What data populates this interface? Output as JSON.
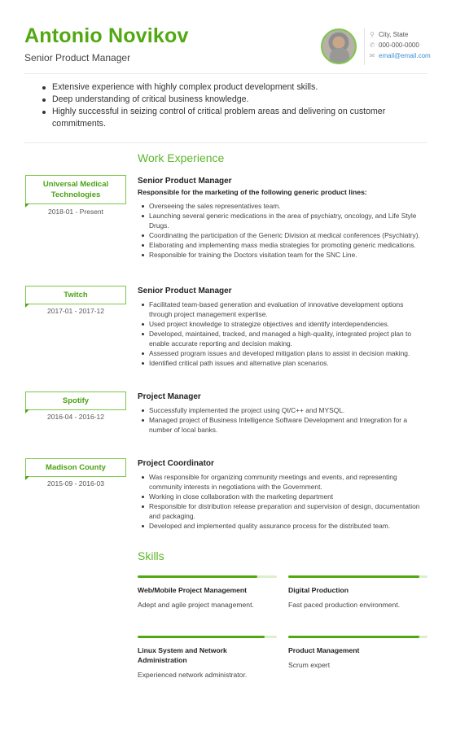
{
  "header": {
    "name": "Antonio Novikov",
    "title": "Senior Product Manager",
    "contact": {
      "location": "City, State",
      "phone": "000-000-0000",
      "email": "email@email.com"
    },
    "icons": {
      "location": "map-pin-icon",
      "phone": "phone-icon",
      "email": "envelope-icon"
    }
  },
  "summary": [
    "Extensive experience with highly complex product development skills.",
    "Deep understanding of critical business knowledge.",
    "Highly successful in seizing control of critical problem areas and delivering on customer commitments."
  ],
  "work_experience": {
    "heading": "Work Experience",
    "jobs": [
      {
        "company": "Universal Medical Technologies",
        "dates": "2018-01 - Present",
        "title": "Senior Product Manager",
        "subtitle": "Responsible for the marketing of the following generic product lines:",
        "bullets": [
          "Overseeing the sales representatives team.",
          "Launching several generic medications in the area of psychiatry, oncology, and Life Style Drugs.",
          "Coordinating the participation of the Generic Division at medical conferences (Psychiatry).",
          "Elaborating and implementing mass media strategies for promoting generic medications.",
          "Responsible for training the Doctors visitation team for the SNC Line."
        ]
      },
      {
        "company": "Twitch",
        "dates": "2017-01 - 2017-12",
        "title": "Senior Product Manager",
        "bullets": [
          "Facilitated team-based generation and evaluation of innovative development options through project management expertise.",
          "Used project knowledge to strategize objectives and identify interdependencies.",
          "Developed, maintained, tracked, and managed a high-quality, integrated project plan to enable accurate reporting and decision making.",
          "Assessed program issues and developed mitigation plans to assist in decision making.",
          "Identified critical path issues and alternative plan scenarios."
        ]
      },
      {
        "company": "Spotify",
        "dates": "2016-04 - 2016-12",
        "title": "Project Manager",
        "bullets": [
          "Successfully implemented the project using Qt/C++ and MYSQL.",
          "Managed project of Business Intelligence Software Development and Integration for a number of local banks."
        ]
      },
      {
        "company": "Madison County",
        "dates": "2015-09 - 2016-03",
        "title": "Project Coordinator",
        "bullets": [
          "Was responsible for organizing community meetings and events, and representing community interests in negotiations with the Government.",
          "Working in close collaboration with the marketing department",
          "Responsible for distribution release preparation and supervision of design, documentation and packaging.",
          "Developed and implemented quality assurance process for the distributed team."
        ]
      }
    ]
  },
  "skills": {
    "heading": "Skills",
    "items": [
      {
        "name": "Web/Mobile Project Management",
        "description": "Adept and agile project management.",
        "level_percent": 86
      },
      {
        "name": "Digital Production",
        "description": "Fast paced production environment.",
        "level_percent": 94
      },
      {
        "name": "Linux System and Network Administration",
        "description": "Experienced network administrator.",
        "level_percent": 91
      },
      {
        "name": "Product Management",
        "description": "Scrum expert",
        "level_percent": 94
      }
    ]
  },
  "colors": {
    "accent": "#51a811",
    "accent_light": "#dcefcd",
    "link": "#3d8fd6"
  }
}
